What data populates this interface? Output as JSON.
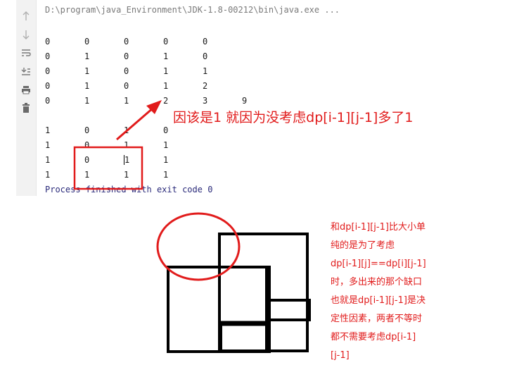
{
  "console": {
    "path_text": "D:\\program\\java_Environment\\JDK-1.8-00212\\bin\\java.exe ...",
    "matrix_a": [
      [
        "0",
        "0",
        "0",
        "0",
        "0"
      ],
      [
        "0",
        "1",
        "0",
        "1",
        "0"
      ],
      [
        "0",
        "1",
        "0",
        "1",
        "1"
      ],
      [
        "0",
        "1",
        "0",
        "1",
        "2"
      ],
      [
        "0",
        "1",
        "1",
        "2",
        "3",
        "9"
      ]
    ],
    "matrix_b": [
      [
        "1",
        "0",
        "1",
        "0"
      ],
      [
        "1",
        "0",
        "1",
        "1"
      ],
      [
        "1",
        "0",
        "1",
        "1"
      ],
      [
        "1",
        "1",
        "1",
        "1"
      ]
    ],
    "exit_text": "Process finished with exit code 0",
    "toolbar_icons": [
      "arrow-up-icon",
      "arrow-down-icon",
      "wrap-icon",
      "scroll-to-end-icon",
      "print-icon",
      "trash-icon"
    ]
  },
  "annotation": {
    "arrow_text": "因该是1 就因为没考虑dp[i-1][j-1]多了1",
    "note_lines": [
      "和dp[i-1][j-1]比大小单",
      "纯的是为了考虑",
      "dp[i-1][j]==dp[i][j-1]",
      "时，多出来的那个缺口",
      "也就是dp[i-1][j-1]是决",
      "定性因素，两者不等时",
      "都不需要考虑dp[i-1]",
      "[j-1]"
    ],
    "accent_color": "#e11b1b"
  }
}
